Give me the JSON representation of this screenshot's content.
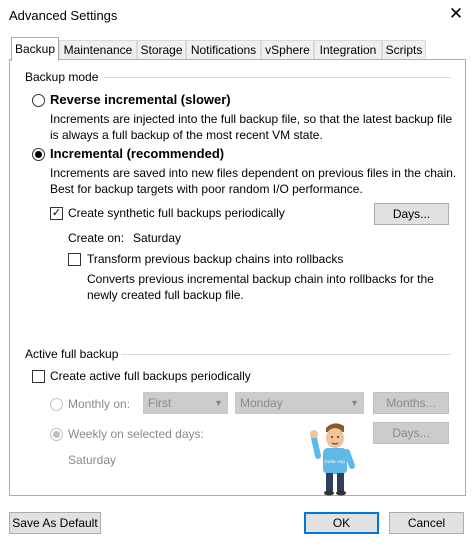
{
  "window": {
    "title": "Advanced Settings",
    "close_symbol": "✕"
  },
  "tabs": [
    {
      "label": "Backup",
      "active": true
    },
    {
      "label": "Maintenance"
    },
    {
      "label": "Storage"
    },
    {
      "label": "Notifications"
    },
    {
      "label": "vSphere"
    },
    {
      "label": "Integration"
    },
    {
      "label": "Scripts"
    }
  ],
  "backup_mode": {
    "group_label": "Backup mode",
    "reverse": {
      "label": "Reverse incremental (slower)",
      "selected": false,
      "desc1": "Increments are injected into the full backup file, so that the latest backup file",
      "desc2": "is always a full backup of the most recent VM state."
    },
    "incremental": {
      "label": "Incremental (recommended)",
      "selected": true,
      "desc1": "Increments are saved into new files dependent on previous files in the chain.",
      "desc2": "Best for backup targets with poor random I/O performance."
    },
    "synthetic": {
      "label": "Create synthetic full backups periodically",
      "checked": true,
      "days_button": "Days..."
    },
    "create_on": {
      "label": "Create on:",
      "value": "Saturday"
    },
    "transform": {
      "label": "Transform previous backup chains into rollbacks",
      "checked": false,
      "desc1": "Converts previous incremental backup chain into rollbacks for the",
      "desc2": "newly created full backup file."
    }
  },
  "active_full": {
    "group_label": "Active full backup",
    "create": {
      "label": "Create active full backups periodically",
      "checked": false
    },
    "monthly": {
      "label": "Monthly on:",
      "week_value": "First",
      "day_value": "Monday",
      "months_button": "Months..."
    },
    "weekly": {
      "label": "Weekly on selected days:",
      "days_button": "Days...",
      "value": "Saturday"
    }
  },
  "mascot": {
    "shirt_text": "hello vsp"
  },
  "footer": {
    "save_default": "Save As Default",
    "ok": "OK",
    "cancel": "Cancel"
  },
  "colors": {
    "accent": "#0078d7",
    "disabled_text": "#8a8a8a",
    "mascot_shirt": "#5fb8e6"
  }
}
